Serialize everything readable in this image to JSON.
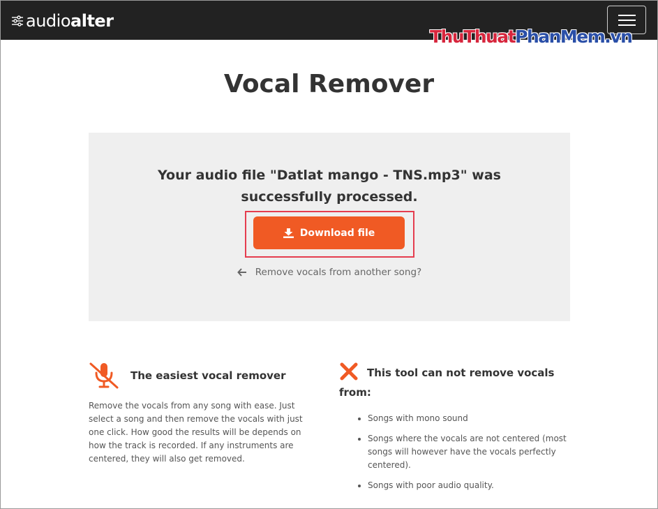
{
  "navbar": {
    "brand_light": "audio",
    "brand_bold": "alter",
    "brand_icon": "sliders-icon",
    "menu_icon": "hamburger-menu-icon",
    "bg_color": "#222222"
  },
  "watermark": {
    "part1": "ThuThuat",
    "part2": "PhanMem",
    "part3": ".vn"
  },
  "page": {
    "title": "Vocal Remover"
  },
  "result": {
    "message": "Your audio file \"Datlat mango - TNS.mp3\" was successfully processed.",
    "download_label": "Download file",
    "download_icon": "download-icon",
    "back_label": "Remove vocals from another song?",
    "back_icon": "arrow-left-icon",
    "accent_color": "#f05a24",
    "highlight_color": "#e53d4f"
  },
  "features": {
    "left": {
      "icon": "microphone-slash-icon",
      "title": "The easiest vocal remover",
      "description": "Remove the vocals from any song with ease. Just select a song and then remove the vocals with just one click. How good the results will be depends on how the track is recorded. If any instruments are centered, they will also get removed."
    },
    "right": {
      "icon": "x-icon",
      "title": "This tool can not remove vocals from:",
      "items": [
        "Songs with mono sound",
        "Songs where the vocals are not centered (most songs will however have the vocals perfectly centered).",
        "Songs with poor audio quality."
      ]
    }
  }
}
